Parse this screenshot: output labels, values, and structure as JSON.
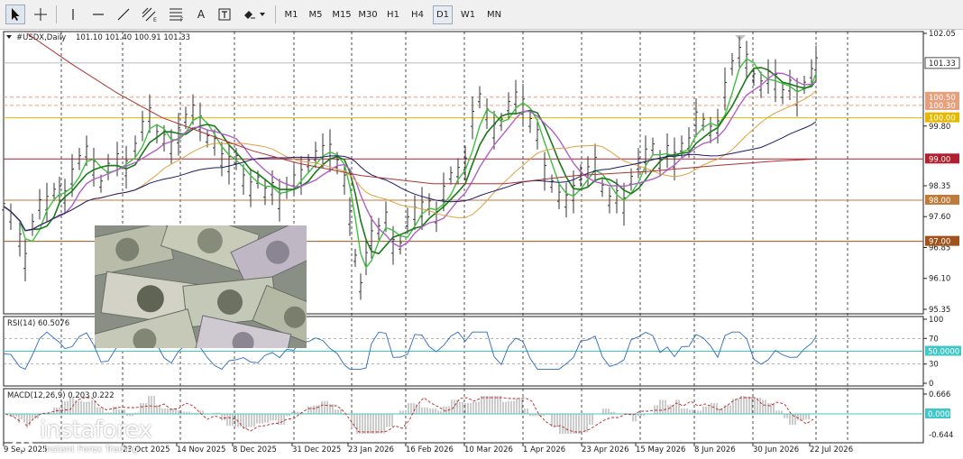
{
  "toolbar": {
    "timeframes": [
      "M1",
      "M5",
      "M15",
      "M30",
      "H1",
      "H4",
      "D1",
      "W1",
      "MN"
    ],
    "active_timeframe": "D1",
    "tool_letter": "A"
  },
  "chart": {
    "symbol_label": "#USDX,Daily",
    "ohlc": "101.10 101.40 100.91 101.33",
    "current_price": "101.33",
    "price_axis": [
      "102.05",
      "99.80",
      "98.35",
      "97.60",
      "96.85",
      "96.10",
      "95.35"
    ],
    "level_tags": [
      {
        "label": "100.50",
        "color": "#e7a07d"
      },
      {
        "label": "100.30",
        "color": "#e7a07d"
      },
      {
        "label": "100.00",
        "color": "#e6b800"
      },
      {
        "label": "99.00",
        "color": "#b0202e"
      },
      {
        "label": "98.00",
        "color": "#c07a3a"
      },
      {
        "label": "97.00",
        "color": "#a0521a"
      }
    ],
    "date_axis": [
      "9 Sep 2025",
      "23 Oct 2025",
      "14 Nov 2025",
      "8 Dec 2025",
      "31 Dec 2025",
      "23 Jan 2026",
      "16 Feb 2026",
      "10 Mar 2026",
      "1 Apr 2026",
      "23 Apr 2026",
      "15 May 2026",
      "8 Jun 2026",
      "30 Jun 2026",
      "22 Jul 2026"
    ]
  },
  "rsi": {
    "label": "RSI(14) 60.5076",
    "axis": [
      "100",
      "70",
      "30",
      "0"
    ],
    "level_tag": "50.0000"
  },
  "macd": {
    "label": "MACD(12,26,9) 0.203 0.222",
    "axis": [
      "0.666",
      "-0.644"
    ],
    "zero_tag": "0.000"
  },
  "watermark": {
    "brand": "instaforex",
    "tagline": "Instant Forex Trading"
  },
  "colors": {
    "price_line": "#333333",
    "ema_fast": "#1a7a1a",
    "ema_bright": "#3fbf3f",
    "ma_purple": "#b060c8",
    "ma_orange": "#e0a040",
    "ma_navy": "#1a1a6a",
    "ma_red": "#b03030",
    "rsi_line": "#2a6bbf",
    "rsi_level": "#40c8c8"
  }
}
